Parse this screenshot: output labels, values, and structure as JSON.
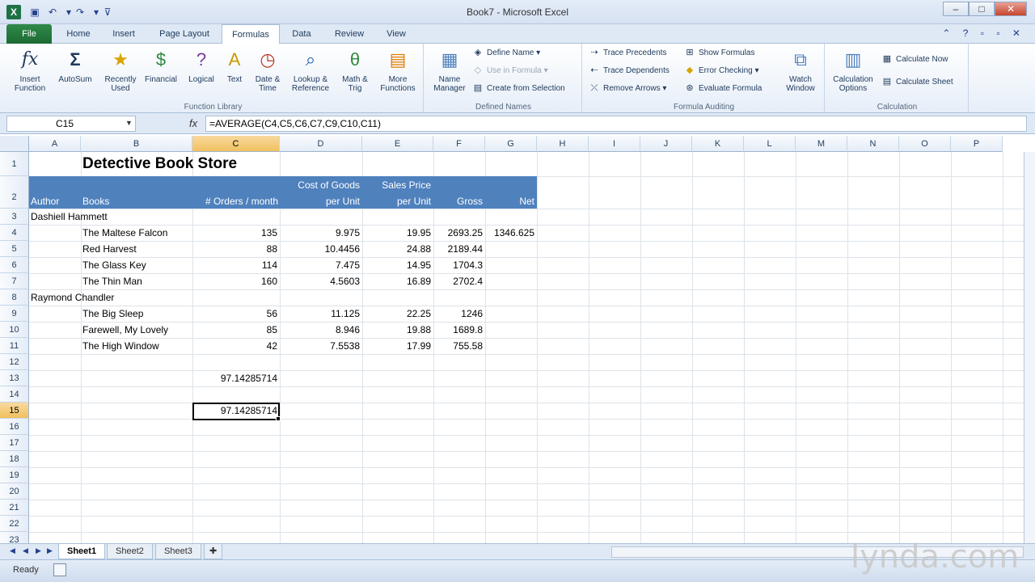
{
  "window": {
    "title": "Book7 - Microsoft Excel",
    "minimize": "–",
    "maximize": "□",
    "close": "✕"
  },
  "ribbon_tabs": [
    "File",
    "Home",
    "Insert",
    "Page Layout",
    "Formulas",
    "Data",
    "Review",
    "View"
  ],
  "active_tab": "Formulas",
  "function_library": {
    "label": "Function Library",
    "buttons": [
      {
        "label": "Insert Function",
        "icon": "fx"
      },
      {
        "label": "AutoSum",
        "icon": "Σ"
      },
      {
        "label": "Recently Used",
        "icon": "★"
      },
      {
        "label": "Financial",
        "icon": "$"
      },
      {
        "label": "Logical",
        "icon": "?"
      },
      {
        "label": "Text",
        "icon": "A"
      },
      {
        "label": "Date & Time",
        "icon": "◷"
      },
      {
        "label": "Lookup & Reference",
        "icon": "⌕"
      },
      {
        "label": "Math & Trig",
        "icon": "θ"
      },
      {
        "label": "More Functions",
        "icon": "▤"
      }
    ]
  },
  "defined_names": {
    "label": "Defined Names",
    "name_manager": "Name Manager",
    "define_name": "Define Name",
    "use_in_formula": "Use in Formula",
    "create_from_selection": "Create from Selection"
  },
  "formula_auditing": {
    "label": "Formula Auditing",
    "trace_precedents": "Trace Precedents",
    "trace_dependents": "Trace Dependents",
    "remove_arrows": "Remove Arrows",
    "show_formulas": "Show Formulas",
    "error_checking": "Error Checking",
    "evaluate_formula": "Evaluate Formula",
    "watch_window": "Watch Window"
  },
  "calculation": {
    "label": "Calculation",
    "options": "Calculation Options",
    "calculate_now": "Calculate Now",
    "calculate_sheet": "Calculate Sheet"
  },
  "formula_bar": {
    "name_box": "C15",
    "formula": "=AVERAGE(C4,C5,C6,C7,C9,C10,C11)",
    "fx": "fx"
  },
  "columns": [
    "A",
    "B",
    "C",
    "D",
    "E",
    "F",
    "G",
    "H",
    "I",
    "J",
    "K",
    "L",
    "M",
    "N",
    "O",
    "P"
  ],
  "rows": [
    "1",
    "2",
    "3",
    "4",
    "5",
    "6",
    "7",
    "8",
    "9",
    "10",
    "11",
    "12",
    "13",
    "14",
    "15",
    "16",
    "17",
    "18",
    "19",
    "20",
    "21",
    "22",
    "23"
  ],
  "sheet": {
    "title": "Detective Book Store",
    "headers": {
      "author": "Author",
      "books": "Books",
      "orders": "# Orders / month",
      "cogs_1": "Cost of Goods",
      "cogs_2": "per Unit",
      "price_1": "Sales Price",
      "price_2": "per Unit",
      "gross": "Gross",
      "net": "Net"
    },
    "authors": [
      "Dashiell Hammett",
      "Raymond Chandler"
    ],
    "books": [
      {
        "title": "The Maltese Falcon",
        "orders": "135",
        "cogs": "9.975",
        "price": "19.95",
        "gross": "2693.25",
        "net": "1346.625"
      },
      {
        "title": "Red Harvest",
        "orders": "88",
        "cogs": "10.4456",
        "price": "24.88",
        "gross": "2189.44",
        "net": ""
      },
      {
        "title": "The Glass Key",
        "orders": "114",
        "cogs": "7.475",
        "price": "14.95",
        "gross": "1704.3",
        "net": ""
      },
      {
        "title": "The Thin Man",
        "orders": "160",
        "cogs": "4.5603",
        "price": "16.89",
        "gross": "2702.4",
        "net": ""
      },
      {
        "title": "The Big Sleep",
        "orders": "56",
        "cogs": "11.125",
        "price": "22.25",
        "gross": "1246",
        "net": ""
      },
      {
        "title": "Farewell, My Lovely",
        "orders": "85",
        "cogs": "8.946",
        "price": "19.88",
        "gross": "1689.8",
        "net": ""
      },
      {
        "title": "The High Window",
        "orders": "42",
        "cogs": "7.5538",
        "price": "17.99",
        "gross": "755.58",
        "net": ""
      }
    ],
    "c13": "97.14285714",
    "c15": "97.14285714"
  },
  "sheet_tabs": [
    "Sheet1",
    "Sheet2",
    "Sheet3"
  ],
  "status": {
    "ready": "Ready"
  },
  "watermark": "lynda.com",
  "colors": {
    "header_band": "#4f81bd",
    "file_tab": "#1e7145"
  }
}
